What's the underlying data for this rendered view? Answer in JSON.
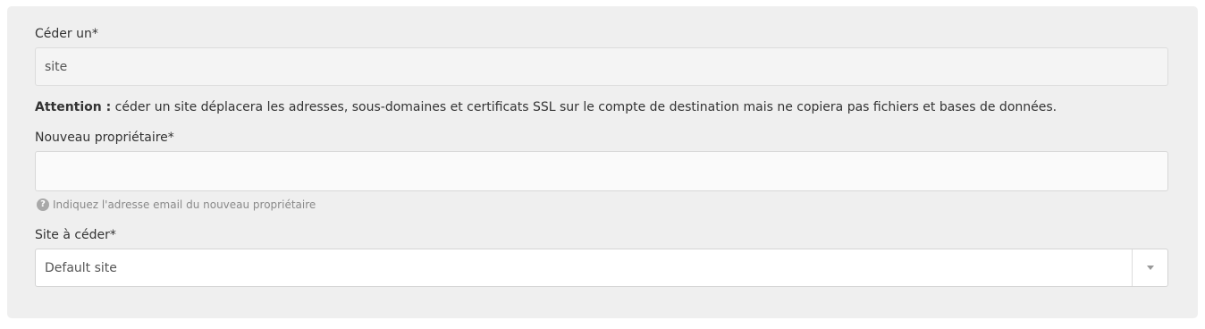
{
  "form": {
    "transfer_type": {
      "label": "Céder un*",
      "value": "site"
    },
    "notice": {
      "strong": "Attention :",
      "text": " céder un site déplacera les adresses, sous-domaines et certificats SSL sur le compte de destination mais ne copiera pas fichiers et bases de données."
    },
    "new_owner": {
      "label": "Nouveau propriétaire*",
      "value": "",
      "placeholder": "",
      "help_icon": "question-circle-icon",
      "help": "Indiquez l'adresse email du nouveau propriétaire"
    },
    "site": {
      "label": "Site à céder*",
      "selected": "Default site",
      "arrow_icon": "caret-down-icon"
    }
  }
}
